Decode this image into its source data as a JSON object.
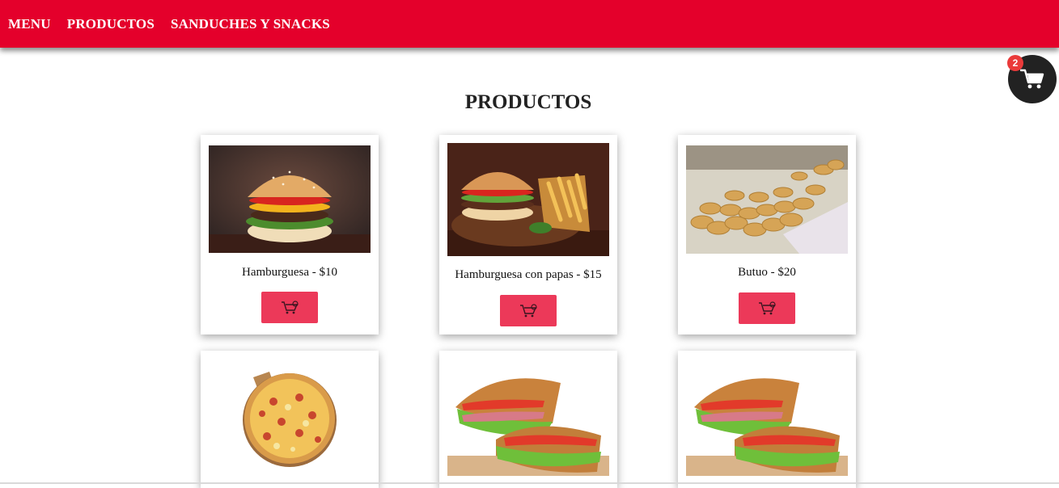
{
  "nav": {
    "items": [
      {
        "label": "MENU"
      },
      {
        "label": "PRODUCTOS"
      },
      {
        "label": "SANDUCHES Y SNACKS"
      }
    ]
  },
  "cart": {
    "count": "2",
    "icon": "shopping-cart-icon"
  },
  "page": {
    "title": "PRODUCTOS"
  },
  "products": [
    {
      "name": "Hamburguesa - $10",
      "image": "burger-photo"
    },
    {
      "name": "Hamburguesa con papas - $15",
      "image": "burger-with-fries-photo"
    },
    {
      "name": "Butuo - $20",
      "image": "empanadas-photo"
    },
    {
      "name": "",
      "image": "pizza-photo"
    },
    {
      "name": "",
      "image": "sandwich-photo"
    },
    {
      "name": "",
      "image": "sandwich-photo"
    }
  ],
  "colors": {
    "navbar": "#e4002b",
    "button": "#ec3959",
    "cart_fab": "#222222",
    "badge": "#ea3a3a"
  }
}
